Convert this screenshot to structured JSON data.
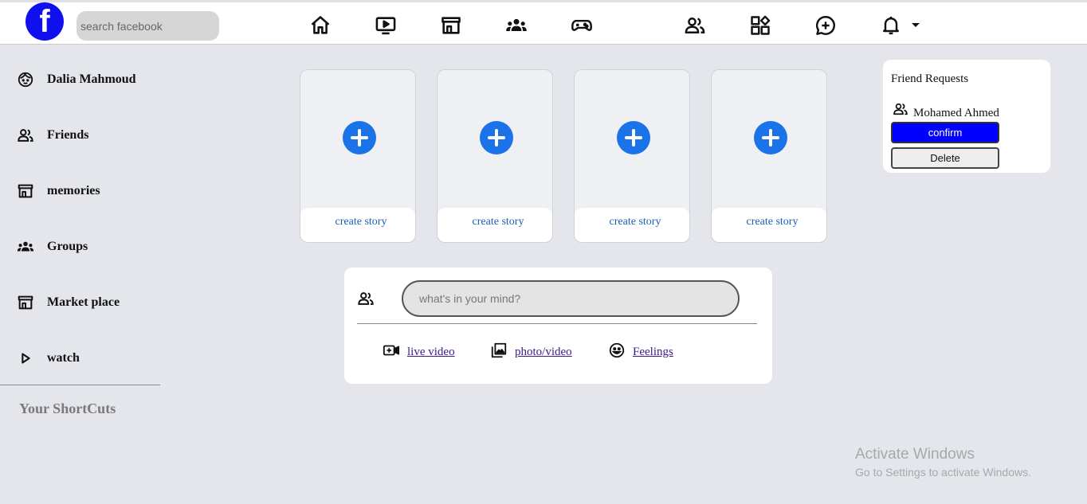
{
  "header": {
    "logo_text": "f",
    "search_placeholder": "search facebook",
    "icons": [
      "home-icon",
      "watch-icon",
      "marketplace-icon",
      "groups-icon",
      "gaming-icon",
      "friends-icon",
      "menu-icon",
      "messenger-icon",
      "notifications-icon",
      "account-caret-icon"
    ]
  },
  "sidebar": {
    "items": [
      {
        "label": "Dalia Mahmoud",
        "icon": "profile-face-icon"
      },
      {
        "label": "Friends",
        "icon": "friends-icon"
      },
      {
        "label": "memories",
        "icon": "store-icon"
      },
      {
        "label": "Groups",
        "icon": "groups-icon"
      },
      {
        "label": "Market place",
        "icon": "store-icon"
      },
      {
        "label": "watch",
        "icon": "play-icon"
      }
    ],
    "shortcuts_title": "Your ShortCuts"
  },
  "stories": [
    {
      "label": "create story"
    },
    {
      "label": "create story"
    },
    {
      "label": "create story"
    },
    {
      "label": "create story"
    }
  ],
  "composer": {
    "placeholder": "what's in your mind?",
    "actions": [
      {
        "label": "live video",
        "icon": "video-plus-icon"
      },
      {
        "label": "photo/video",
        "icon": "photo-library-icon"
      },
      {
        "label": "Feelings",
        "icon": "smiley-icon"
      }
    ]
  },
  "friend_requests": {
    "title": "Friend Requests",
    "name": "Mohamed Ahmed",
    "confirm_label": "confirm",
    "delete_label": "Delete"
  },
  "watermark": {
    "line1": "Activate Windows",
    "line2": "Go to Settings to activate Windows."
  },
  "colors": {
    "logo_bg": "#1010ef",
    "plus_blue": "#1a73e8",
    "confirm_bg": "#0000ff",
    "page_bg": "#e4e6eb"
  }
}
